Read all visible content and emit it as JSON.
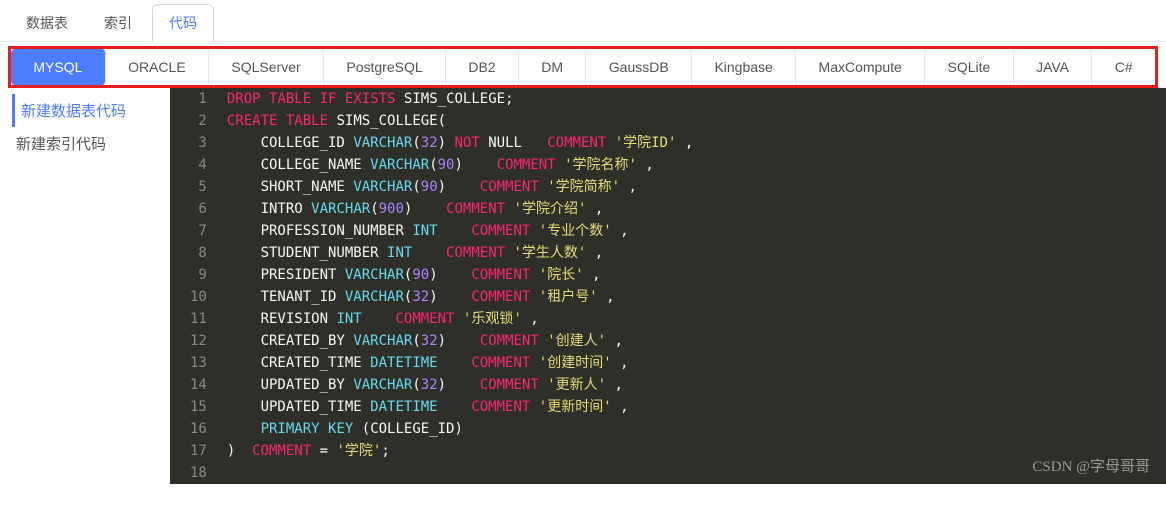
{
  "topTabs": {
    "t0": "数据表",
    "t1": "索引",
    "t2": "代码"
  },
  "dbTabs": {
    "d0": "MYSQL",
    "d1": "ORACLE",
    "d2": "SQLServer",
    "d3": "PostgreSQL",
    "d4": "DB2",
    "d5": "DM",
    "d6": "GaussDB",
    "d7": "Kingbase",
    "d8": "MaxCompute",
    "d9": "SQLite",
    "d10": "JAVA",
    "d11": "C#"
  },
  "sidebar": {
    "s0": "新建数据表代码",
    "s1": "新建索引代码"
  },
  "lines": {
    "l1": "1",
    "l2": "2",
    "l3": "3",
    "l4": "4",
    "l5": "5",
    "l6": "6",
    "l7": "7",
    "l8": "8",
    "l9": "9",
    "l10": "10",
    "l11": "11",
    "l12": "12",
    "l13": "13",
    "l14": "14",
    "l15": "15",
    "l16": "16",
    "l17": "17",
    "l18": "18"
  },
  "code": {
    "drop": "DROP",
    "table": "TABLE",
    "if": "IF",
    "exists": "EXISTS",
    "tname": "SIMS_COLLEGE",
    "semi": ";",
    "create": "CREATE",
    "lparen": "(",
    "c1": "COLLEGE_ID",
    "vc": "VARCHAR",
    "n32": "32",
    "not": "NOT",
    "null": "NULL",
    "cmt": "COMMENT",
    "s1": "'学院ID'",
    "comma": " ,",
    "c2": "COLLEGE_NAME",
    "n90": "90",
    "s2": "'学院名称'",
    "c3": "SHORT_NAME",
    "s3": "'学院简称'",
    "c4": "INTRO",
    "n900": "900",
    "s4": "'学院介绍'",
    "c5": "PROFESSION_NUMBER",
    "int": "INT",
    "s5": "'专业个数'",
    "c6": "STUDENT_NUMBER",
    "s6": "'学生人数'",
    "c7": "PRESIDENT",
    "s7": "'院长'",
    "c8": "TENANT_ID",
    "s8": "'租户号'",
    "c9": "REVISION",
    "s9": "'乐观锁'",
    "c10": "CREATED_BY",
    "s10": "'创建人'",
    "c11": "CREATED_TIME",
    "dt": "DATETIME",
    "s11": "'创建时间'",
    "c12": "UPDATED_BY",
    "s12": "'更新人'",
    "c13": "UPDATED_TIME",
    "s13": "'更新时间'",
    "pk": "PRIMARY",
    "key": "KEY",
    "pkc": "(COLLEGE_ID)",
    "rparen": ")",
    "eq": " = ",
    "sfinal": "'学院'"
  },
  "watermark": "CSDN @字母哥哥"
}
